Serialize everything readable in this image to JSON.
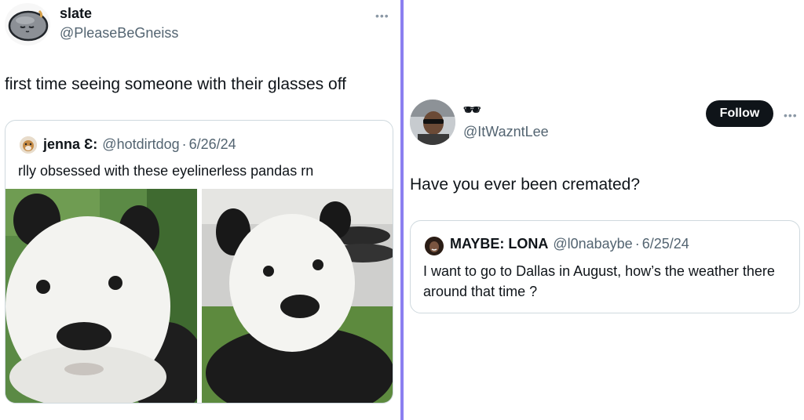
{
  "left_tweet": {
    "author": {
      "display_name": "slate",
      "handle": "@PleaseBeGneiss"
    },
    "text": "first time seeing someone with their glasses off",
    "more_label": "•••",
    "quote": {
      "author_name": "jenna Ɛ:",
      "handle": "@hotdirtdog",
      "separator": "·",
      "date": "6/26/24",
      "text": "rlly obsessed with these eyelinerless pandas rn",
      "images": [
        "panda-photo-1",
        "panda-photo-2"
      ]
    }
  },
  "right_tweet": {
    "author": {
      "display_name": "🕶",
      "handle": "@ItWazntLee"
    },
    "follow_label": "Follow",
    "more_label": "•••",
    "text": "Have you ever been cremated?",
    "quote": {
      "author_name": "MAYBE: LONA",
      "handle": "@l0nabaybe",
      "separator": "·",
      "date": "6/25/24",
      "text": "I want to go to Dallas in August, how’s the weather there around that time ?"
    }
  },
  "colors": {
    "divider": "#8b7ff0",
    "text": "#0f1419",
    "muted": "#536471",
    "border": "#cfd9de",
    "follow_bg": "#0f1419"
  }
}
